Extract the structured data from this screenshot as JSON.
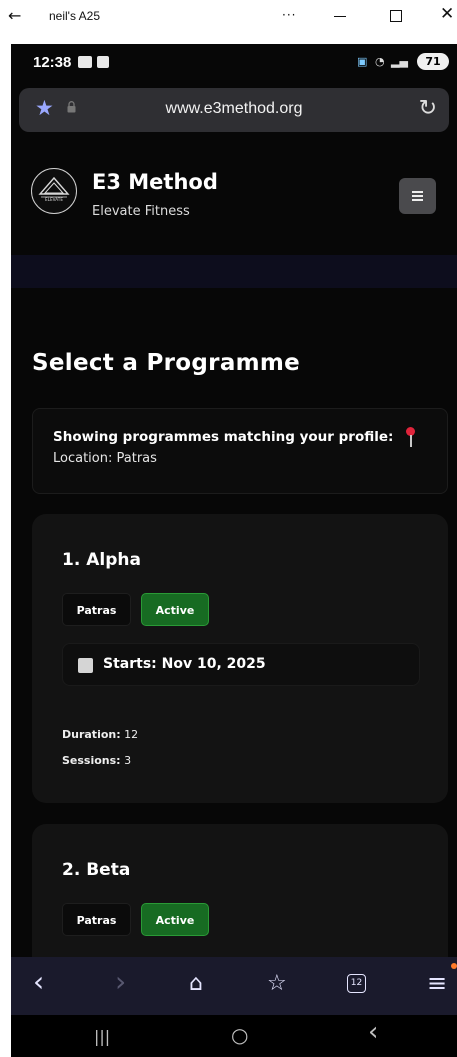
{
  "window": {
    "title": "neil's A25",
    "more": "···"
  },
  "status": {
    "time": "12:38",
    "battery": "71"
  },
  "browser": {
    "url": "www.e3method.org",
    "tab_count": "12"
  },
  "site": {
    "brand": "E3 Method",
    "tagline": "Elevate Fitness",
    "logo_text": "ELEVATE"
  },
  "page": {
    "title": "Select a Programme",
    "filter_text": "Showing programmes matching your profile:",
    "location_text": "Location: Patras"
  },
  "programmes": [
    {
      "title": "1. Alpha",
      "location": "Patras",
      "status": "Active",
      "starts": "Starts: Nov 10, 2025",
      "duration_label": "Duration:",
      "duration": "12",
      "sessions_label": "Sessions:",
      "sessions": "3"
    },
    {
      "title": "2. Beta",
      "location": "Patras",
      "status": "Active"
    }
  ],
  "colors": {
    "active": "#176b22",
    "page_bg": "#070707",
    "card_bg": "#131313",
    "toolbar_bg": "#1a1a2c"
  },
  "icons": {
    "back": "←",
    "close": "✕",
    "star": "★",
    "lock": "🔒",
    "reload": "↻",
    "nav_back": "‹",
    "nav_forward": "›",
    "home": "⌂",
    "bookmark": "☆",
    "menu": "≡",
    "recents": "|||",
    "home_sys": "○",
    "back_sys": "‹"
  }
}
